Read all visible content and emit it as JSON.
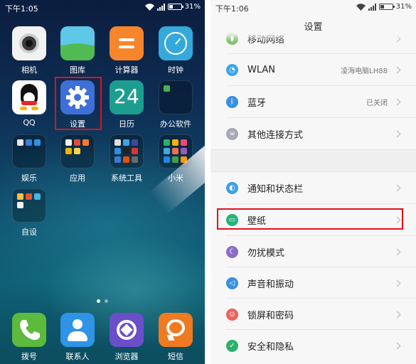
{
  "home": {
    "status": {
      "time": "下午1:05",
      "battery": "31%"
    },
    "apps": [
      {
        "label": "相机"
      },
      {
        "label": "图库"
      },
      {
        "label": "计算器"
      },
      {
        "label": "时钟"
      },
      {
        "label": "QQ"
      },
      {
        "label": "设置"
      },
      {
        "label": "日历",
        "number": "24"
      },
      {
        "label": "办公软件"
      },
      {
        "label": "娱乐"
      },
      {
        "label": "应用"
      },
      {
        "label": "系统工具"
      },
      {
        "label": "小米"
      },
      {
        "label": "自设"
      }
    ],
    "dock": [
      {
        "label": "拨号"
      },
      {
        "label": "联系人"
      },
      {
        "label": "浏览器"
      },
      {
        "label": "短信"
      }
    ],
    "highlight_color": "#e0111b"
  },
  "settings": {
    "status": {
      "time": "下午1:06",
      "battery": "31%"
    },
    "title": "设置",
    "rows": [
      {
        "label": "移动网络",
        "value": "",
        "color": "#7cc36a",
        "icon": "mobile-network-icon"
      },
      {
        "label": "WLAN",
        "value": "凌海电脑LH88",
        "color": "#3ba6ea",
        "icon": "wifi-icon"
      },
      {
        "label": "蓝牙",
        "value": "已关闭",
        "color": "#3a8fe0",
        "icon": "bluetooth-icon"
      },
      {
        "label": "其他连接方式",
        "value": "",
        "color": "#a8a8b6",
        "icon": "link-icon"
      },
      {
        "label": "通知和状态栏",
        "value": "",
        "color": "#3aa0e8",
        "icon": "toggle-icon"
      },
      {
        "label": "壁纸",
        "value": "",
        "color": "#22b47a",
        "icon": "wallpaper-icon"
      },
      {
        "label": "勿扰模式",
        "value": "",
        "color": "#8a6ec6",
        "icon": "moon-icon"
      },
      {
        "label": "声音和振动",
        "value": "",
        "color": "#3a8fe0",
        "icon": "speaker-icon"
      },
      {
        "label": "锁屏和密码",
        "value": "",
        "color": "#f0625a",
        "icon": "lock-icon"
      },
      {
        "label": "安全和隐私",
        "value": "",
        "color": "#2fb06a",
        "icon": "shield-icon"
      }
    ]
  }
}
